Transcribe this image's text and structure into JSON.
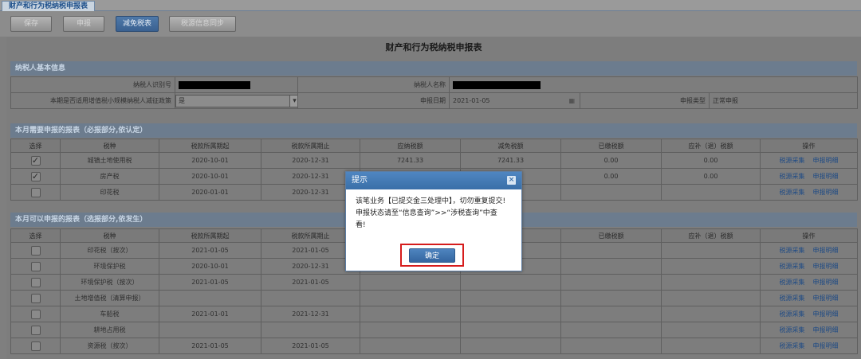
{
  "tab": {
    "label": "财产和行为税纳税申报表"
  },
  "toolbar": {
    "save": "保存",
    "declare": "申报",
    "reduce": "减免税表",
    "sync": "税源信息同步"
  },
  "form_title": "财产和行为税纳税申报表",
  "basic": {
    "header": "纳税人基本信息",
    "taxpayer_id_label": "纳税人识别号",
    "taxpayer_name_label": "纳税人名称",
    "small_policy_label": "本期是否适用增值税小规模纳税人减征政策",
    "small_policy_value": "是",
    "declare_date_label": "申报日期",
    "declare_date_value": "2021-01-05",
    "declare_type_label": "申报类型",
    "declare_type_value": "正常申报"
  },
  "required": {
    "header": "本月需要申报的报表（必报部分,依认定）",
    "columns": [
      "选择",
      "税种",
      "税款所属期起",
      "税款所属期止",
      "应纳税额",
      "减免税额",
      "已缴税额",
      "应补（退）税额",
      "操作"
    ],
    "rows": [
      {
        "checked": "✓",
        "tax": "城镇土地使用税",
        "start": "2020-10-01",
        "end": "2020-12-31",
        "due": "7241.33",
        "relief": "7241.33",
        "paid": "0.00",
        "balance": "0.00"
      },
      {
        "checked": "✓",
        "tax": "房产税",
        "start": "2020-10-01",
        "end": "2020-12-31",
        "due": "",
        "relief": "",
        "paid": "0.00",
        "balance": "0.00"
      },
      {
        "checked": "",
        "tax": "印花税",
        "start": "2020-01-01",
        "end": "2020-12-31",
        "due": "",
        "relief": "",
        "paid": "",
        "balance": ""
      }
    ]
  },
  "optional": {
    "header": "本月可以申报的报表（选报部分,依发生）",
    "columns": [
      "选择",
      "税种",
      "税款所属期起",
      "税款所属期止",
      "",
      "",
      "已缴税额",
      "应补（退）税额",
      "操作"
    ],
    "rows": [
      {
        "tax": "印花税（按次）",
        "start": "2021-01-05",
        "end": "2021-01-05"
      },
      {
        "tax": "环境保护税",
        "start": "2020-10-01",
        "end": "2020-12-31"
      },
      {
        "tax": "环境保护税（按次）",
        "start": "2021-01-05",
        "end": "2021-01-05"
      },
      {
        "tax": "土地增值税（清算申报）",
        "start": "",
        "end": ""
      },
      {
        "tax": "车船税",
        "start": "2021-01-01",
        "end": "2021-12-31"
      },
      {
        "tax": "耕地占用税",
        "start": "",
        "end": ""
      },
      {
        "tax": "资源税（按次）",
        "start": "2021-01-05",
        "end": "2021-01-05"
      }
    ]
  },
  "actions": {
    "collect": "税源采集",
    "detail": "申报明细"
  },
  "dialog": {
    "title": "提示",
    "close": "×",
    "line1": "该笔业务【已提交金三处理中】，切勿重复提交!",
    "line2": "申报状态请至“信息查询”>>“涉税查询”中查",
    "line3": "看!",
    "ok": "确定"
  },
  "colors": {
    "dialog_header": "#3a6fa8",
    "highlight": "#d61c1c",
    "link": "#1f4b85"
  }
}
